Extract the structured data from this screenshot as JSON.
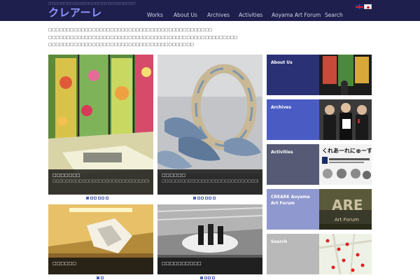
{
  "header": {
    "tagline": "□□□□□□□□□□□□□□□□□□□□□□□□□□□□",
    "logo": "クレアーレ",
    "nav": [
      {
        "label": "Works"
      },
      {
        "label": "About Us"
      },
      {
        "label": "Archives"
      },
      {
        "label": "Activities"
      },
      {
        "label": "Aoyama Art Forum"
      },
      {
        "label": "Search"
      }
    ],
    "colors": {
      "bar": "#1f1f4d",
      "logo": "#8e96ff"
    }
  },
  "intro": {
    "lines": [
      "□□□□□□□□□□□□□□□□□□□□□□□□□□□□□□□□□□□□□□□□□□□□□",
      "□□□□□□□□□□□□□□□□□□□□□□□□□□□□□□□□□□□□□□□□□□□□□□□□□□□□",
      "□□□□□□□□□□□□□□□□□□□□□□□□□□□□□□□□□□□□□□□□"
    ]
  },
  "works": [
    {
      "title": "□□□□□□□",
      "subtitle": "□□□□□□□□□□□□□□□□□□□□□□□□□□□□□□□□□□□□□",
      "dots": 6,
      "active_dot": 0
    },
    {
      "title": "□□□□□□",
      "subtitle": "□□□□□□□□□□□□□□□□□□□□□□□□□□□□□□□□□□□□□",
      "dots": 6,
      "active_dot": 0
    },
    {
      "title": "□□□□□□",
      "subtitle": "",
      "dots": 2,
      "active_dot": 0
    },
    {
      "title": "□□□□□□□□□□",
      "subtitle": "",
      "dots": 4,
      "active_dot": 0
    }
  ],
  "side_menu": [
    {
      "label": "About Us",
      "color": "#2a3275"
    },
    {
      "label": "Archives",
      "color": "#4a5cc4"
    },
    {
      "label": "Activities",
      "color": "#565a74"
    },
    {
      "label": "CREARE Aoyama Art Forum",
      "color": "#8f99cf"
    },
    {
      "label": "Search",
      "color": "#b9b9b9"
    }
  ],
  "activities_banner_text": "くれあーれにゅーす"
}
